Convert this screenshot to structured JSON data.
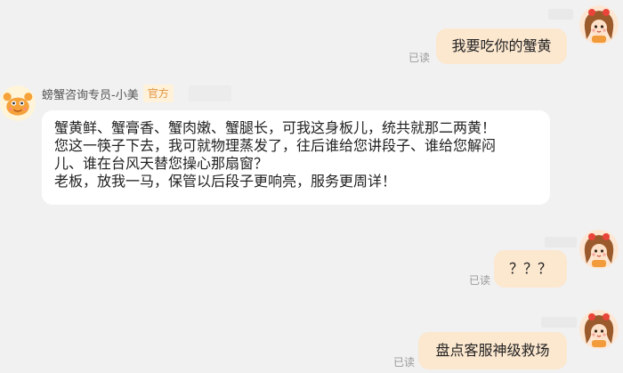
{
  "colors": {
    "background": "#f1f1f1",
    "self_bubble": "#fce7cf",
    "other_bubble": "#ffffff",
    "official_badge_bg": "#fff1da",
    "official_badge_text": "#e0933d",
    "read_text": "#9a9a9a"
  },
  "read_status": "已读",
  "agent": {
    "name": "螃蟹咨询专员-小美",
    "badge": "官方",
    "avatar_icon": "crab-mascot-icon"
  },
  "user": {
    "avatar_icon": "girl-avatar-icon"
  },
  "messages": [
    {
      "sender": "user",
      "text": "我要吃你的蟹黄",
      "read": "已读"
    },
    {
      "sender": "agent",
      "lines": [
        "蟹黄鲜、蟹膏香、蟹肉嫩、蟹腿长，可我这身板儿，统共就那二两黄！",
        "您这一筷子下去，我可就物理蒸发了，往后谁给您讲段子、谁给您解闷",
        "儿、谁在台风天替您操心那扇窗？",
        "老板，放我一马，保管以后段子更响亮，服务更周详！"
      ]
    },
    {
      "sender": "user",
      "text": "？？？",
      "read": "已读"
    },
    {
      "sender": "user",
      "text": "盘点客服神级救场",
      "read": "已读"
    }
  ]
}
